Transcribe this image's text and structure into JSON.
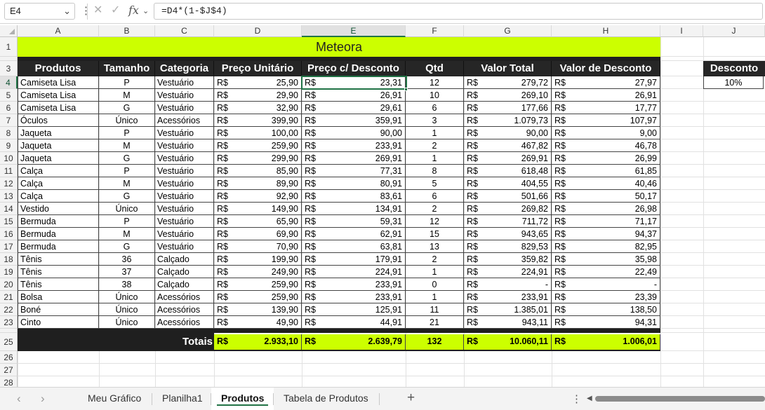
{
  "formula_bar": {
    "name_box": "E4",
    "formula": "=D4*(1-$J$4)"
  },
  "columns": [
    "A",
    "B",
    "C",
    "D",
    "E",
    "F",
    "G",
    "H",
    "I",
    "J"
  ],
  "selected_column": "E",
  "selected_row": "4",
  "title": "Meteora",
  "headers": [
    "Produtos",
    "Tamanho",
    "Categoria",
    "Preço Unitário",
    "Preço c/ Desconto",
    "Qtd",
    "Valor Total",
    "Valor de Desconto"
  ],
  "currency": "R$",
  "rows": [
    {
      "num": "4",
      "produto": "Camiseta Lisa",
      "tamanho": "P",
      "categoria": "Vestuário",
      "preco": "25,90",
      "preco_desc": "23,31",
      "qtd": "12",
      "total": "279,72",
      "desconto": "27,97"
    },
    {
      "num": "5",
      "produto": "Camiseta Lisa",
      "tamanho": "M",
      "categoria": "Vestuário",
      "preco": "29,90",
      "preco_desc": "26,91",
      "qtd": "10",
      "total": "269,10",
      "desconto": "26,91"
    },
    {
      "num": "6",
      "produto": "Camiseta Lisa",
      "tamanho": "G",
      "categoria": "Vestuário",
      "preco": "32,90",
      "preco_desc": "29,61",
      "qtd": "6",
      "total": "177,66",
      "desconto": "17,77"
    },
    {
      "num": "7",
      "produto": "Óculos",
      "tamanho": "Único",
      "categoria": "Acessórios",
      "preco": "399,90",
      "preco_desc": "359,91",
      "qtd": "3",
      "total": "1.079,73",
      "desconto": "107,97"
    },
    {
      "num": "8",
      "produto": "Jaqueta",
      "tamanho": "P",
      "categoria": "Vestuário",
      "preco": "100,00",
      "preco_desc": "90,00",
      "qtd": "1",
      "total": "90,00",
      "desconto": "9,00"
    },
    {
      "num": "9",
      "produto": "Jaqueta",
      "tamanho": "M",
      "categoria": "Vestuário",
      "preco": "259,90",
      "preco_desc": "233,91",
      "qtd": "2",
      "total": "467,82",
      "desconto": "46,78"
    },
    {
      "num": "10",
      "produto": "Jaqueta",
      "tamanho": "G",
      "categoria": "Vestuário",
      "preco": "299,90",
      "preco_desc": "269,91",
      "qtd": "1",
      "total": "269,91",
      "desconto": "26,99"
    },
    {
      "num": "11",
      "produto": "Calça",
      "tamanho": "P",
      "categoria": "Vestuário",
      "preco": "85,90",
      "preco_desc": "77,31",
      "qtd": "8",
      "total": "618,48",
      "desconto": "61,85"
    },
    {
      "num": "12",
      "produto": "Calça",
      "tamanho": "M",
      "categoria": "Vestuário",
      "preco": "89,90",
      "preco_desc": "80,91",
      "qtd": "5",
      "total": "404,55",
      "desconto": "40,46"
    },
    {
      "num": "13",
      "produto": "Calça",
      "tamanho": "G",
      "categoria": "Vestuário",
      "preco": "92,90",
      "preco_desc": "83,61",
      "qtd": "6",
      "total": "501,66",
      "desconto": "50,17"
    },
    {
      "num": "14",
      "produto": "Vestido",
      "tamanho": "Único",
      "categoria": "Vestuário",
      "preco": "149,90",
      "preco_desc": "134,91",
      "qtd": "2",
      "total": "269,82",
      "desconto": "26,98"
    },
    {
      "num": "15",
      "produto": "Bermuda",
      "tamanho": "P",
      "categoria": "Vestuário",
      "preco": "65,90",
      "preco_desc": "59,31",
      "qtd": "12",
      "total": "711,72",
      "desconto": "71,17"
    },
    {
      "num": "16",
      "produto": "Bermuda",
      "tamanho": "M",
      "categoria": "Vestuário",
      "preco": "69,90",
      "preco_desc": "62,91",
      "qtd": "15",
      "total": "943,65",
      "desconto": "94,37"
    },
    {
      "num": "17",
      "produto": "Bermuda",
      "tamanho": "G",
      "categoria": "Vestuário",
      "preco": "70,90",
      "preco_desc": "63,81",
      "qtd": "13",
      "total": "829,53",
      "desconto": "82,95"
    },
    {
      "num": "18",
      "produto": "Tênis",
      "tamanho": "36",
      "categoria": "Calçado",
      "preco": "199,90",
      "preco_desc": "179,91",
      "qtd": "2",
      "total": "359,82",
      "desconto": "35,98"
    },
    {
      "num": "19",
      "produto": "Tênis",
      "tamanho": "37",
      "categoria": "Calçado",
      "preco": "249,90",
      "preco_desc": "224,91",
      "qtd": "1",
      "total": "224,91",
      "desconto": "22,49"
    },
    {
      "num": "20",
      "produto": "Tênis",
      "tamanho": "38",
      "categoria": "Calçado",
      "preco": "259,90",
      "preco_desc": "233,91",
      "qtd": "0",
      "total": "-",
      "desconto": "-"
    },
    {
      "num": "21",
      "produto": "Bolsa",
      "tamanho": "Único",
      "categoria": "Acessórios",
      "preco": "259,90",
      "preco_desc": "233,91",
      "qtd": "1",
      "total": "233,91",
      "desconto": "23,39"
    },
    {
      "num": "22",
      "produto": "Boné",
      "tamanho": "Único",
      "categoria": "Acessórios",
      "preco": "139,90",
      "preco_desc": "125,91",
      "qtd": "11",
      "total": "1.385,01",
      "desconto": "138,50"
    },
    {
      "num": "23",
      "produto": "Cinto",
      "tamanho": "Único",
      "categoria": "Acessórios",
      "preco": "49,90",
      "preco_desc": "44,91",
      "qtd": "21",
      "total": "943,11",
      "desconto": "94,31"
    }
  ],
  "totals": {
    "label": "Totais",
    "preco": "2.933,10",
    "preco_desc": "2.639,79",
    "qtd": "132",
    "total": "10.060,11",
    "desconto": "1.006,01"
  },
  "discount": {
    "header": "Desconto",
    "value": "10%"
  },
  "sheet_tabs": [
    {
      "label": "Meu Gráfico"
    },
    {
      "label": "Planilha1"
    },
    {
      "label": "Produtos",
      "active": true
    },
    {
      "label": "Tabela de Produtos"
    }
  ],
  "colors": {
    "title_bg": "#ccff00",
    "header_bg": "#262626",
    "accent": "#217346"
  }
}
